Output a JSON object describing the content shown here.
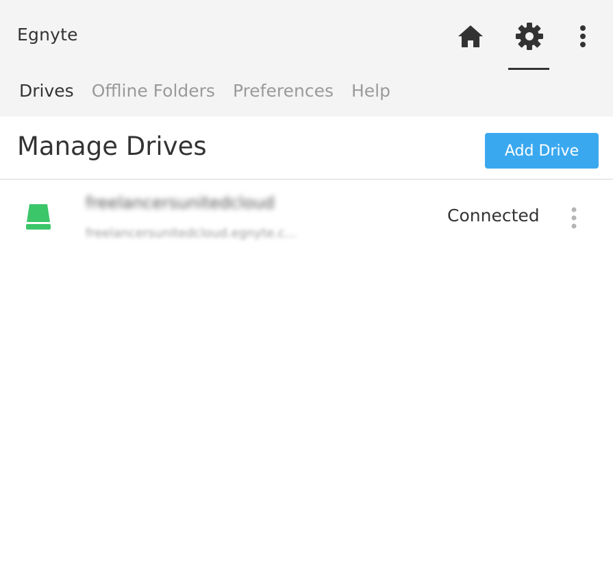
{
  "header": {
    "app_title": "Egnyte",
    "icons": {
      "home": "home-icon",
      "settings": "gear-icon",
      "more": "more-vertical-icon"
    },
    "tabs": [
      {
        "label": "Drives",
        "active": true
      },
      {
        "label": "Offline Folders",
        "active": false
      },
      {
        "label": "Preferences",
        "active": false
      },
      {
        "label": "Help",
        "active": false
      }
    ]
  },
  "main": {
    "title": "Manage Drives",
    "add_button_label": "Add Drive",
    "drives": [
      {
        "name": "freelancersunitedcloud",
        "url": "freelancersunitedcloud.egnyte.c...",
        "status": "Connected",
        "icon": "drive-icon"
      }
    ]
  },
  "colors": {
    "accent": "#3aa8ef",
    "drive_icon": "#3cc66a",
    "header_bg": "#f4f4f4",
    "text_primary": "#333333",
    "text_muted": "#9a9a9a"
  }
}
